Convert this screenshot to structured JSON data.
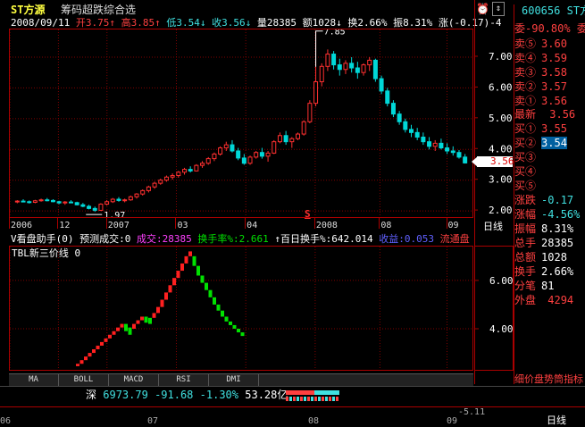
{
  "title": {
    "name": "ST方源",
    "indicator": "筹码超跌综合选"
  },
  "quote_line": {
    "date": "2008/09/11",
    "open": "开3.75",
    "high": "高3.85",
    "low": "低3.54",
    "close": "收3.56",
    "volume": "量28385",
    "amount": "额1028",
    "turnover": "换2.66%",
    "amplitude": "振8.31%",
    "change": "涨(-0.17)-4"
  },
  "main_chart": {
    "y_ticks": [
      "7.00",
      "6.00",
      "5.00",
      "4.00",
      "3.00",
      "2.00"
    ],
    "y_values": [
      7,
      6,
      5,
      4,
      3,
      2
    ],
    "y_range": [
      1.8,
      7.9
    ],
    "x_ticks": [
      "2006",
      "12",
      "2007",
      "03",
      "04",
      "2008",
      "08",
      "09"
    ],
    "label_high": "7.85",
    "label_low": "1.97",
    "current_price": "3.56",
    "period": "日线",
    "marker": "S",
    "candles": [
      [
        2.3,
        2.35,
        2.25,
        2.32
      ],
      [
        2.32,
        2.38,
        2.28,
        2.3
      ],
      [
        2.3,
        2.34,
        2.24,
        2.28
      ],
      [
        2.28,
        2.36,
        2.25,
        2.33
      ],
      [
        2.33,
        2.4,
        2.3,
        2.36
      ],
      [
        2.36,
        2.42,
        2.31,
        2.34
      ],
      [
        2.34,
        2.38,
        2.28,
        2.3
      ],
      [
        2.3,
        2.33,
        2.22,
        2.26
      ],
      [
        2.26,
        2.32,
        2.2,
        2.29
      ],
      [
        2.29,
        2.35,
        2.25,
        2.27
      ],
      [
        2.27,
        2.3,
        2.18,
        2.2
      ],
      [
        2.2,
        2.26,
        2.12,
        2.15
      ],
      [
        2.15,
        2.2,
        2.05,
        2.08
      ],
      [
        2.08,
        2.14,
        1.97,
        2.02
      ],
      [
        2.02,
        2.25,
        2.0,
        2.22
      ],
      [
        2.22,
        2.35,
        2.18,
        2.3
      ],
      [
        2.3,
        2.42,
        2.26,
        2.38
      ],
      [
        2.38,
        2.45,
        2.3,
        2.34
      ],
      [
        2.34,
        2.4,
        2.28,
        2.36
      ],
      [
        2.36,
        2.5,
        2.33,
        2.46
      ],
      [
        2.46,
        2.58,
        2.4,
        2.55
      ],
      [
        2.55,
        2.7,
        2.5,
        2.66
      ],
      [
        2.66,
        2.82,
        2.6,
        2.78
      ],
      [
        2.78,
        2.95,
        2.72,
        2.9
      ],
      [
        2.9,
        3.05,
        2.85,
        3.0
      ],
      [
        3.0,
        3.15,
        2.95,
        3.1
      ],
      [
        3.1,
        3.22,
        3.02,
        3.15
      ],
      [
        3.15,
        3.3,
        3.08,
        3.26
      ],
      [
        3.26,
        3.4,
        3.18,
        3.35
      ],
      [
        3.35,
        3.45,
        3.25,
        3.3
      ],
      [
        3.3,
        3.52,
        3.28,
        3.48
      ],
      [
        3.48,
        3.62,
        3.4,
        3.55
      ],
      [
        3.55,
        3.75,
        3.5,
        3.7
      ],
      [
        3.7,
        3.9,
        3.62,
        3.85
      ],
      [
        3.85,
        4.1,
        3.8,
        4.05
      ],
      [
        4.05,
        4.25,
        3.95,
        4.15
      ],
      [
        4.15,
        4.3,
        3.9,
        3.95
      ],
      [
        3.95,
        4.05,
        3.65,
        3.72
      ],
      [
        3.72,
        3.85,
        3.5,
        3.55
      ],
      [
        3.55,
        3.8,
        3.5,
        3.75
      ],
      [
        3.75,
        3.95,
        3.7,
        3.9
      ],
      [
        3.9,
        4.05,
        3.7,
        3.78
      ],
      [
        3.78,
        3.95,
        3.6,
        3.88
      ],
      [
        3.88,
        4.3,
        3.85,
        4.25
      ],
      [
        4.25,
        4.55,
        4.2,
        4.45
      ],
      [
        4.45,
        4.6,
        4.15,
        4.25
      ],
      [
        4.25,
        4.4,
        4.05,
        4.35
      ],
      [
        4.35,
        4.55,
        4.3,
        4.5
      ],
      [
        4.5,
        4.95,
        4.45,
        4.9
      ],
      [
        4.9,
        5.6,
        4.85,
        5.5
      ],
      [
        5.5,
        7.85,
        5.4,
        6.2
      ],
      [
        6.2,
        6.8,
        6.05,
        6.7
      ],
      [
        6.7,
        7.25,
        6.55,
        7.1
      ],
      [
        7.1,
        7.2,
        6.6,
        6.75
      ],
      [
        6.75,
        6.95,
        6.4,
        6.6
      ],
      [
        6.6,
        6.9,
        6.45,
        6.8
      ],
      [
        6.8,
        7.0,
        6.5,
        6.65
      ],
      [
        6.65,
        6.85,
        6.3,
        6.5
      ],
      [
        6.5,
        6.8,
        6.4,
        6.75
      ],
      [
        6.75,
        7.0,
        6.55,
        6.9
      ],
      [
        6.9,
        6.95,
        6.2,
        6.3
      ],
      [
        6.3,
        6.4,
        5.8,
        5.9
      ],
      [
        5.9,
        6.0,
        5.4,
        5.5
      ],
      [
        5.5,
        5.6,
        5.05,
        5.15
      ],
      [
        5.15,
        5.25,
        4.8,
        4.9
      ],
      [
        4.9,
        5.0,
        4.55,
        4.65
      ],
      [
        4.65,
        4.8,
        4.4,
        4.55
      ],
      [
        4.55,
        4.7,
        4.3,
        4.4
      ],
      [
        4.4,
        4.55,
        4.15,
        4.25
      ],
      [
        4.25,
        4.4,
        4.0,
        4.1
      ],
      [
        4.1,
        4.3,
        3.95,
        4.2
      ],
      [
        4.2,
        4.35,
        4.0,
        4.05
      ],
      [
        4.05,
        4.2,
        3.85,
        3.95
      ],
      [
        3.95,
        4.1,
        3.8,
        3.9
      ],
      [
        3.9,
        3.98,
        3.7,
        3.75
      ],
      [
        3.75,
        3.85,
        3.54,
        3.56
      ]
    ]
  },
  "sub_chart": {
    "title_a": "V看盘助手(0)",
    "title_b": "预测成交:0",
    "vol_label": "成交:28385",
    "turn_label": "换手率%:2.661",
    "hundred_label": "↑百日换手%:642.014",
    "profit_label": "收益:0.053",
    "flow_label": "流通盘",
    "line_name": "TBL新三价线 0",
    "y_ticks": [
      "6.00",
      "4.00"
    ],
    "y_values": [
      6,
      4
    ],
    "y_range": [
      2.3,
      7.4
    ],
    "bricks": [
      [
        2.55,
        2.45,
        1
      ],
      [
        2.7,
        2.55,
        1
      ],
      [
        2.85,
        2.7,
        1
      ],
      [
        3.0,
        2.85,
        1
      ],
      [
        3.15,
        3.0,
        1
      ],
      [
        3.3,
        3.15,
        1
      ],
      [
        3.45,
        3.3,
        1
      ],
      [
        3.6,
        3.45,
        1
      ],
      [
        3.75,
        3.6,
        1
      ],
      [
        3.9,
        3.75,
        1
      ],
      [
        4.05,
        3.9,
        1
      ],
      [
        4.2,
        4.05,
        1
      ],
      [
        4.2,
        3.9,
        0
      ],
      [
        4.05,
        3.75,
        0
      ],
      [
        4.2,
        4.0,
        1
      ],
      [
        4.35,
        4.2,
        1
      ],
      [
        4.5,
        4.35,
        1
      ],
      [
        4.5,
        4.25,
        0
      ],
      [
        4.45,
        4.2,
        0
      ],
      [
        4.65,
        4.45,
        1
      ],
      [
        4.9,
        4.65,
        1
      ],
      [
        5.2,
        4.9,
        1
      ],
      [
        5.5,
        5.2,
        1
      ],
      [
        5.8,
        5.5,
        1
      ],
      [
        6.1,
        5.8,
        1
      ],
      [
        6.4,
        6.1,
        1
      ],
      [
        6.7,
        6.4,
        1
      ],
      [
        7.0,
        6.7,
        1
      ],
      [
        7.2,
        7.0,
        1
      ],
      [
        7.0,
        6.6,
        0
      ],
      [
        6.6,
        6.2,
        0
      ],
      [
        6.2,
        5.9,
        0
      ],
      [
        5.9,
        5.6,
        0
      ],
      [
        5.6,
        5.3,
        0
      ],
      [
        5.3,
        5.0,
        0
      ],
      [
        5.0,
        4.75,
        0
      ],
      [
        4.75,
        4.5,
        0
      ],
      [
        4.5,
        4.3,
        0
      ],
      [
        4.3,
        4.15,
        0
      ],
      [
        4.15,
        4.0,
        0
      ],
      [
        4.0,
        3.85,
        0
      ],
      [
        3.85,
        3.7,
        0
      ]
    ]
  },
  "tabs": [
    "MA",
    "BOLL",
    "MACD",
    "RSI",
    "DMI"
  ],
  "status_bar": {
    "market": "深",
    "index": "6973.79",
    "change": "-91.68",
    "pct": "-1.30%",
    "amount": "53.28亿"
  },
  "bottom_axis": {
    "labels": [
      "06",
      "07",
      "08",
      "09"
    ],
    "value": "-5.11",
    "period": "日线"
  },
  "quote_panel": {
    "code": "600656",
    "name": "ST方",
    "wei_bi": "委-90.80%",
    "wei_cha": "委差",
    "sells": [
      [
        "卖⑤",
        "3.60"
      ],
      [
        "卖④",
        "3.59"
      ],
      [
        "卖③",
        "3.58"
      ],
      [
        "卖②",
        "3.57"
      ],
      [
        "卖①",
        "3.56"
      ]
    ],
    "latest_label": "最新",
    "latest": "3.56",
    "buys": [
      [
        "买①",
        "3.55"
      ],
      [
        "买②",
        "3.54"
      ],
      [
        "买③",
        ""
      ],
      [
        "买④",
        ""
      ],
      [
        "买⑤",
        ""
      ]
    ],
    "stats": [
      [
        "涨跌",
        "-0.17"
      ],
      [
        "涨幅",
        "-4.56%"
      ],
      [
        "振幅",
        "8.31%"
      ],
      [
        "总手",
        "28385"
      ],
      [
        "总额",
        "1028"
      ],
      [
        "换手",
        "2.66%"
      ],
      [
        "分笔",
        "81"
      ]
    ],
    "outer": "外盘",
    "outer_val": "4294",
    "detail": "细价盘势筒指标"
  },
  "colors": {
    "up": "#ff3030",
    "down": "#00d8d8",
    "brick_up": "#ff2020",
    "brick_down": "#00e000",
    "grid": "#800000",
    "frame": "#aa0000"
  }
}
